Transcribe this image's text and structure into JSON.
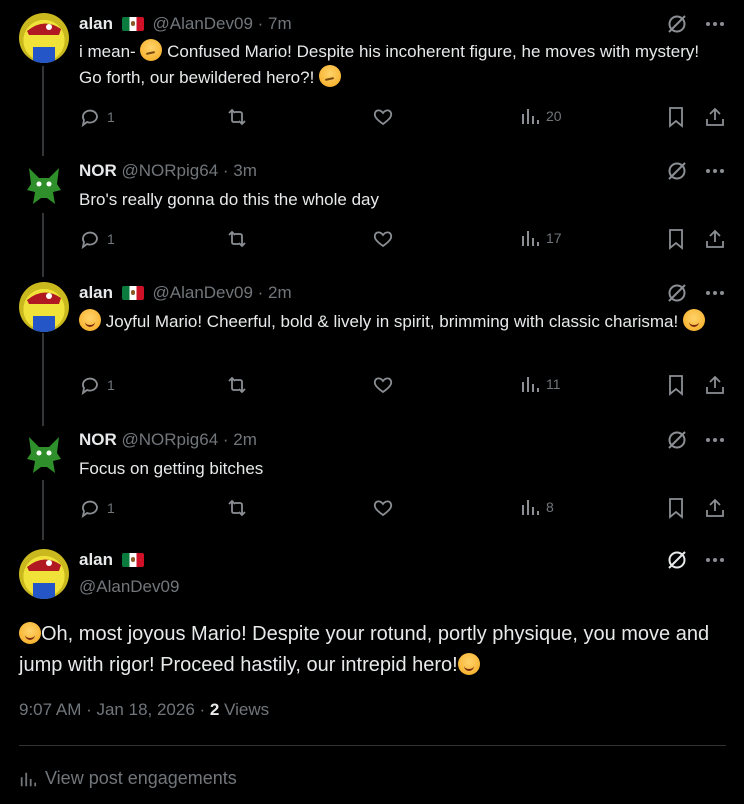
{
  "posts": [
    {
      "name": "alan",
      "handle": "@AlanDev09",
      "time": "· 7m",
      "text_a": "i mean- ",
      "text_b": " Confused Mario! Despite his incoherent figure, he moves with mystery! Go forth, our bewildered hero?! ",
      "replies": "1",
      "views": "20"
    },
    {
      "name": "NOR",
      "handle": "@NORpig64",
      "time": "· 3m",
      "text": "Bro's really gonna do this the whole day",
      "replies": "1",
      "views": "17"
    },
    {
      "name": "alan",
      "handle": "@AlanDev09",
      "time": "· 2m",
      "text": " Joyful Mario! Cheerful, bold & lively in spirit, brimming with classic charisma! ",
      "replies": "1",
      "views": "11"
    },
    {
      "name": "NOR",
      "handle": "@NORpig64",
      "time": "· 2m",
      "text": "Focus on getting bitches",
      "replies": "1",
      "views": "8"
    }
  ],
  "main": {
    "name": "alan",
    "handle": "@AlanDev09",
    "text": "Oh, most joyous Mario! Despite your rotund, portly physique, you move and jump with rigor! Proceed hastily, our intrepid hero!",
    "timestamp": "9:07 AM · Jan 18, 2026 · ",
    "views_count": "2",
    "views_label": " Views",
    "engagements": "View post engagements"
  },
  "colors": {
    "background": "#000000",
    "text": "#e7e9ea",
    "muted": "#71767b",
    "line": "#333639"
  },
  "icons": [
    "grok-icon",
    "more-icon",
    "reply-icon",
    "repost-icon",
    "like-icon",
    "views-icon",
    "bookmark-icon",
    "share-icon"
  ]
}
